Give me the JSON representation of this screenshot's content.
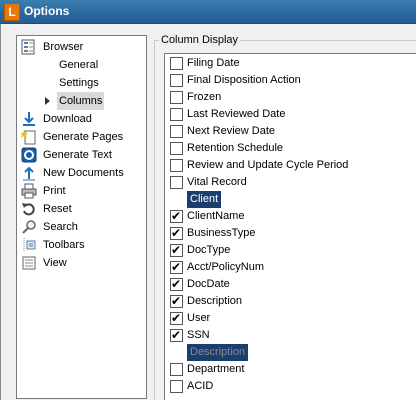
{
  "window": {
    "title": "Options",
    "app_icon_letter": "L"
  },
  "tree": {
    "items": [
      {
        "label": "Browser",
        "icon": "browser-icon"
      },
      {
        "label": "General"
      },
      {
        "label": "Settings"
      },
      {
        "label": "Columns",
        "selected": true
      },
      {
        "label": "Download",
        "icon": "download-icon"
      },
      {
        "label": "Generate Pages",
        "icon": "generate-pages-icon"
      },
      {
        "label": "Generate Text",
        "icon": "generate-text-icon"
      },
      {
        "label": "New Documents",
        "icon": "new-documents-icon"
      },
      {
        "label": "Print",
        "icon": "printer-icon"
      },
      {
        "label": "Reset",
        "icon": "reset-icon"
      },
      {
        "label": "Search",
        "icon": "search-icon"
      },
      {
        "label": "Toolbars",
        "icon": "toolbars-icon"
      },
      {
        "label": "View",
        "icon": "view-icon"
      }
    ]
  },
  "column_display": {
    "title": "Column Display",
    "rows": [
      {
        "label": "Filing Date",
        "checked": false
      },
      {
        "label": "Final Disposition Action",
        "checked": false
      },
      {
        "label": "Frozen",
        "checked": false
      },
      {
        "label": "Last Reviewed Date",
        "checked": false
      },
      {
        "label": "Next Review Date",
        "checked": false
      },
      {
        "label": "Retention Schedule",
        "checked": false
      },
      {
        "label": "Review and Update Cycle Period",
        "checked": false
      },
      {
        "label": "Vital Record",
        "checked": false
      },
      {
        "label": "Client",
        "header": true
      },
      {
        "label": "ClientName",
        "checked": true
      },
      {
        "label": "BusinessType",
        "checked": true
      },
      {
        "label": "DocType",
        "checked": true
      },
      {
        "label": "Acct/PolicyNum",
        "checked": true
      },
      {
        "label": "DocDate",
        "checked": true
      },
      {
        "label": "Description",
        "checked": true
      },
      {
        "label": "User",
        "checked": true
      },
      {
        "label": "SSN",
        "checked": true
      },
      {
        "label": "Description",
        "header": true,
        "disabled": true
      },
      {
        "label": "Department",
        "checked": false
      },
      {
        "label": "ACID",
        "checked": false
      }
    ]
  },
  "colors": {
    "titlebar": "#2b6aa0",
    "header_highlight": "#1a3e6e"
  }
}
